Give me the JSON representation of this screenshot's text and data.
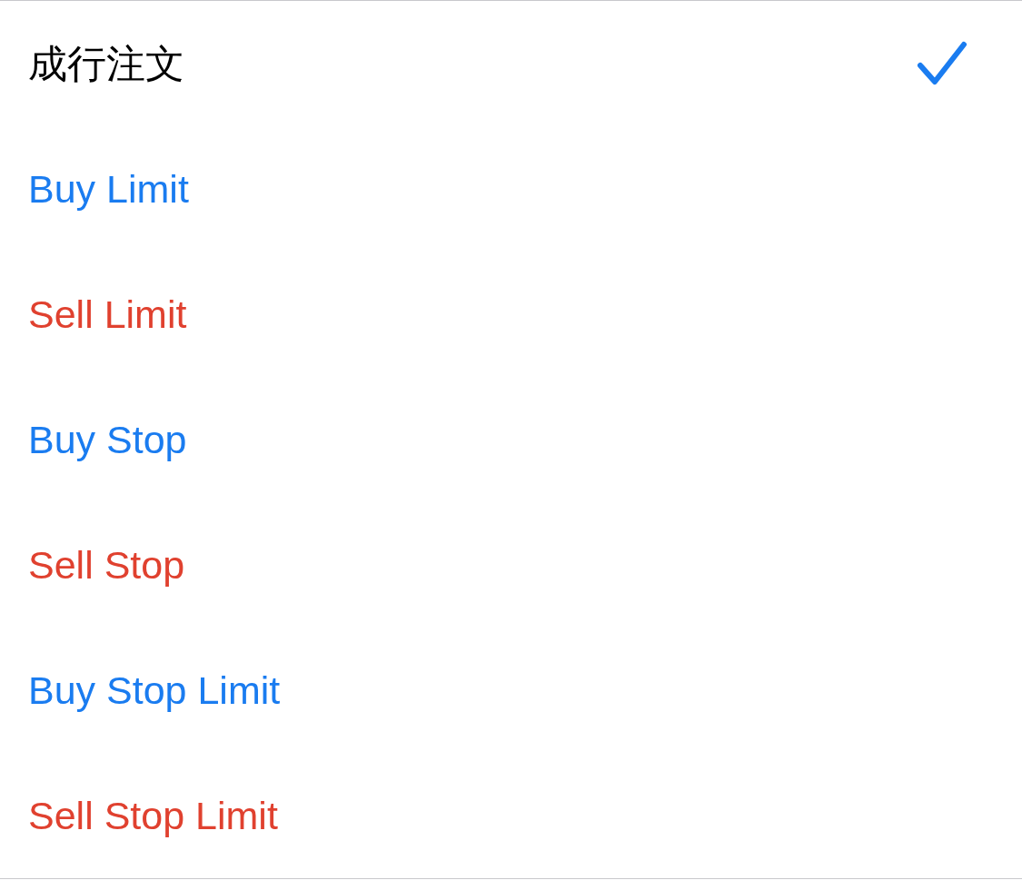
{
  "order_types": [
    {
      "label": "成行注文",
      "color": "#000000",
      "selected": true
    },
    {
      "label": "Buy Limit",
      "color": "#1a7cf0",
      "selected": false
    },
    {
      "label": "Sell Limit",
      "color": "#e0412f",
      "selected": false
    },
    {
      "label": "Buy Stop",
      "color": "#1a7cf0",
      "selected": false
    },
    {
      "label": "Sell Stop",
      "color": "#e0412f",
      "selected": false
    },
    {
      "label": "Buy Stop Limit",
      "color": "#1a7cf0",
      "selected": false
    },
    {
      "label": "Sell Stop Limit",
      "color": "#e0412f",
      "selected": false
    }
  ]
}
